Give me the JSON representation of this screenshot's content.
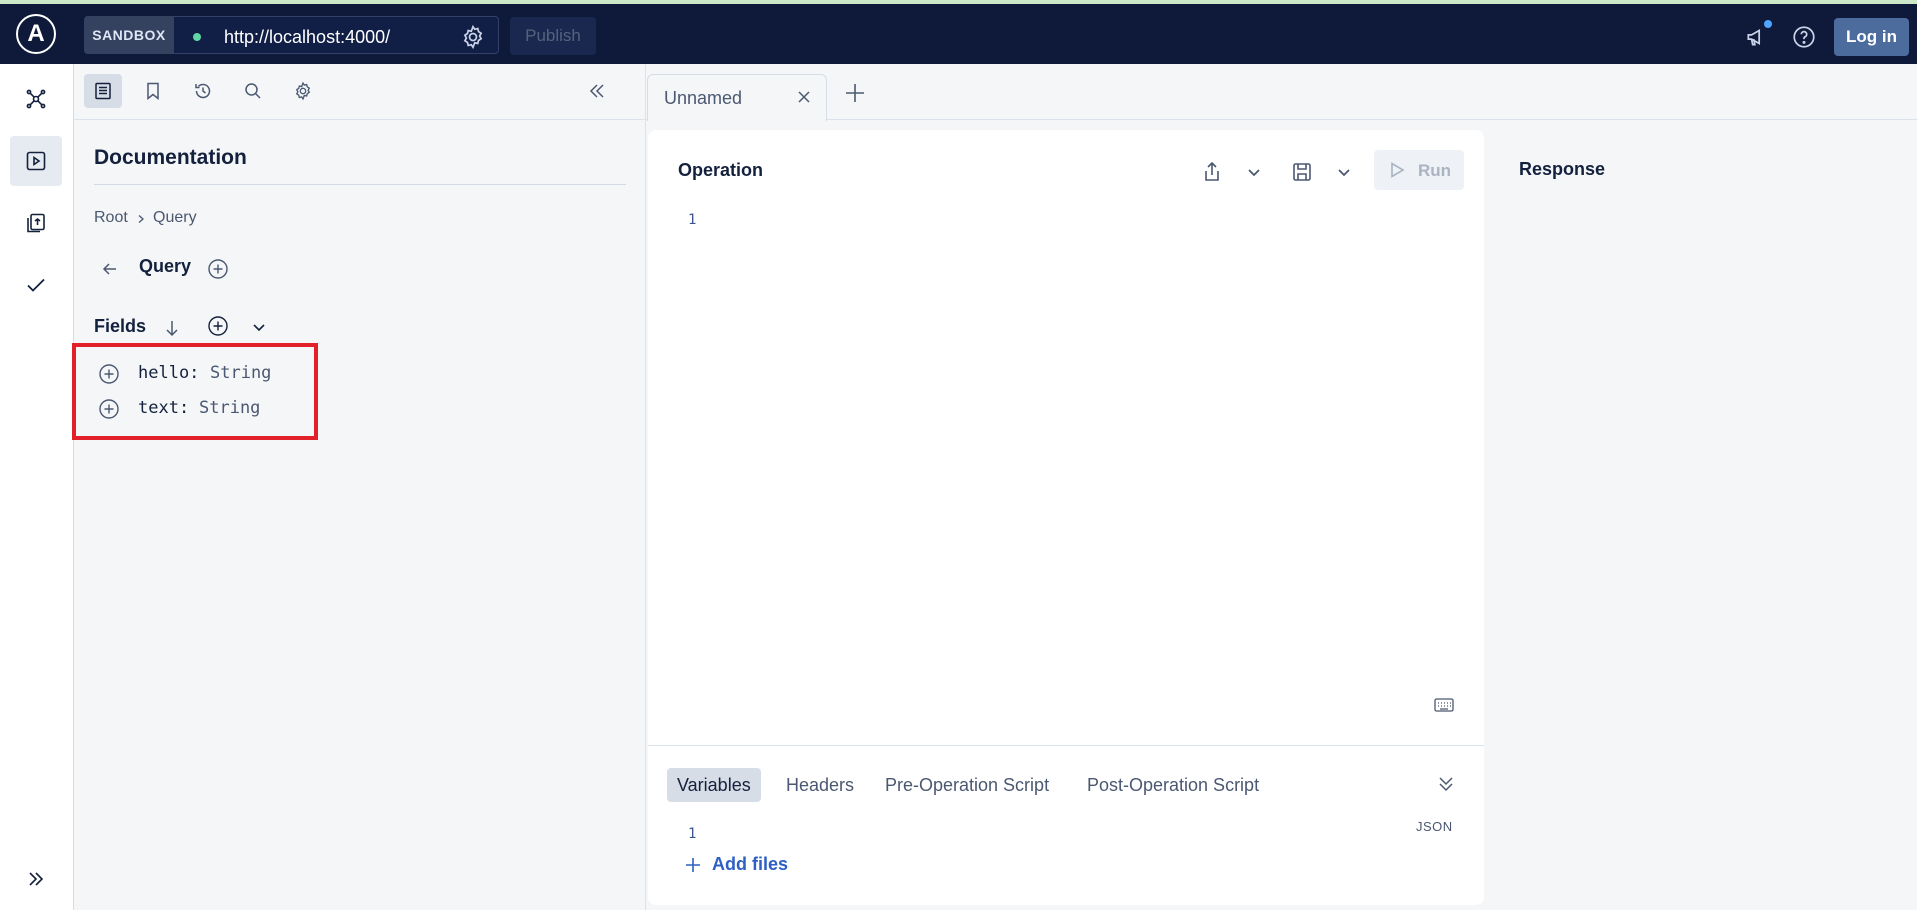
{
  "topbar": {
    "logo_text": "A",
    "sandbox_label": "SANDBOX",
    "url": "http://localhost:4000/",
    "status_color": "#62d6a4",
    "publish_label": "Publish",
    "login_label": "Log in",
    "icons": [
      "gear-icon",
      "megaphone-icon",
      "help-icon"
    ]
  },
  "leftnav": {
    "items": [
      "graph-icon",
      "explorer-icon",
      "schema-icon",
      "checks-icon"
    ],
    "expand_icon": "double-chevron-right-icon"
  },
  "doc_toolbar": {
    "items": [
      "documentation-icon",
      "bookmark-icon",
      "history-icon",
      "search-icon",
      "settings-icon"
    ],
    "collapse_icon": "double-chevron-left-icon"
  },
  "documentation": {
    "title": "Documentation",
    "breadcrumb": [
      "Root",
      "Query"
    ],
    "type_name": "Query",
    "fields_label": "Fields",
    "fields": [
      {
        "name": "hello:",
        "type": "String"
      },
      {
        "name": "text:",
        "type": "String"
      }
    ]
  },
  "tabs": [
    {
      "label": "Unnamed"
    }
  ],
  "operation": {
    "title": "Operation",
    "run_label": "Run",
    "line_numbers": [
      "1"
    ]
  },
  "variables": {
    "tabs": [
      "Variables",
      "Headers",
      "Pre-Operation Script",
      "Post-Operation Script"
    ],
    "json_label": "JSON",
    "line_numbers": [
      "1"
    ],
    "add_files_label": "Add files"
  },
  "response": {
    "title": "Response"
  },
  "colors": {
    "topbar_bg": "#0f1a3a",
    "highlight": "#e1202a",
    "link": "#2d5fc4"
  }
}
